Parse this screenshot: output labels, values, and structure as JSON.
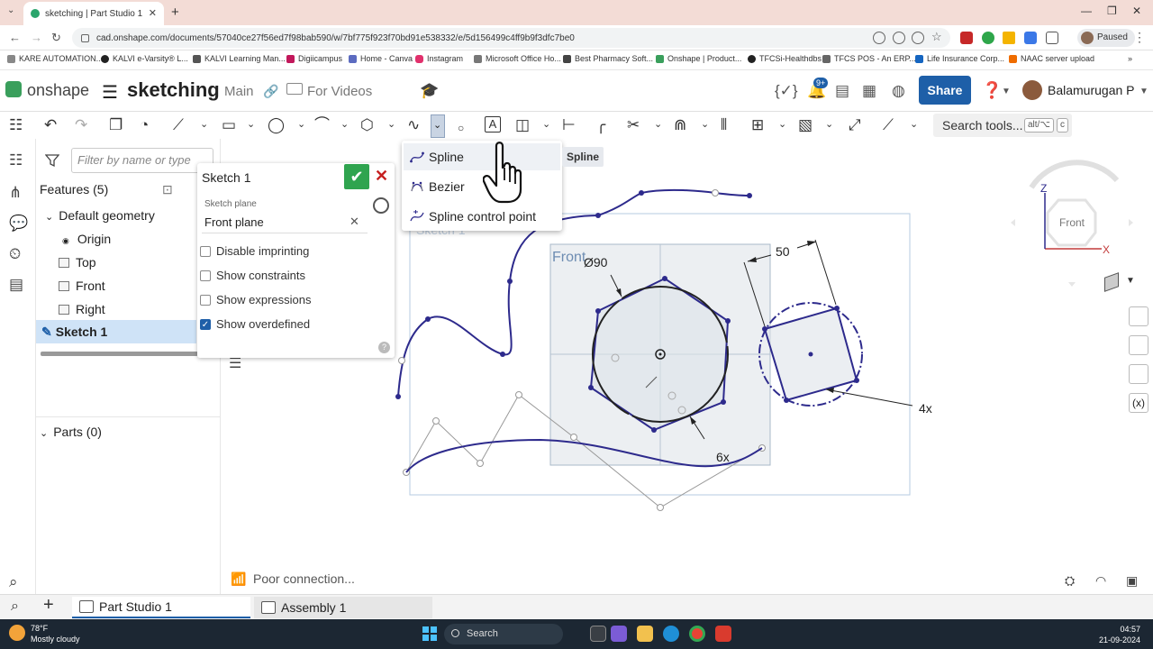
{
  "browser": {
    "tab_title": "sketching | Part Studio 1",
    "url": "cad.onshape.com/documents/57040ce27f56ed7f98bab590/w/7bf775f923f70bd91e538332/e/5d156499c4ff9b9f3dfc7be0",
    "profile_status": "Paused",
    "bookmarks": [
      "KARE AUTOMATION...",
      "KALVI e-Varsity® L...",
      "KALVI Learning Man...",
      "Digiicampus",
      "Home - Canva",
      "Instagram",
      "Microsoft Office Ho...",
      "Best Pharmacy Soft...",
      "Onshape | Product...",
      "TFCSi-Healthdbs",
      "TFCS POS - An ERP...",
      "Life Insurance Corp...",
      "NAAC server upload"
    ],
    "colors": {
      "tabbar": "#f3dcd6"
    }
  },
  "app": {
    "logo_text": "onshape",
    "document_title": "sketching",
    "workspace": "Main",
    "folder": "For Videos",
    "share_label": "Share",
    "notification_count": "9+",
    "user_name": "Balamurugan P",
    "accent": "#1e5fa8"
  },
  "toolbar": {
    "search_label": "Search tools...",
    "search_key1": "alt/⌥",
    "search_key2": "c"
  },
  "dropdown": {
    "items": [
      {
        "label": "Spline",
        "icon": "spline-icon"
      },
      {
        "label": "Bezier",
        "icon": "bezier-icon"
      },
      {
        "label": "Spline control point",
        "icon": "spline-control-point-icon"
      }
    ],
    "tooltip": "Spline"
  },
  "features": {
    "filter_placeholder": "Filter by name or type",
    "header": "Features (5)",
    "default_geometry": "Default geometry",
    "origin": "Origin",
    "top": "Top",
    "front": "Front",
    "right": "Right",
    "sketch": "Sketch 1",
    "parts": "Parts (0)"
  },
  "sketch_dialog": {
    "title": "Sketch 1",
    "plane_label": "Sketch plane",
    "plane_value": "Front plane",
    "options": [
      {
        "label": "Disable imprinting",
        "checked": false
      },
      {
        "label": "Show constraints",
        "checked": false
      },
      {
        "label": "Show expressions",
        "checked": false
      },
      {
        "label": "Show overdefined",
        "checked": true
      }
    ]
  },
  "canvas": {
    "sketch_label": "Sketch 1",
    "plane_label": "Front",
    "dim_diameter": "Ø90",
    "dim_length": "50",
    "dim_hex_count": "6x",
    "dim_square_count": "4x",
    "view_label": "Front",
    "axis_z": "Z",
    "axis_x": "X"
  },
  "status": {
    "connection": "Poor connection..."
  },
  "tabs": {
    "part_studio": "Part Studio 1",
    "assembly": "Assembly 1"
  },
  "taskbar": {
    "temperature": "78°F",
    "weather": "Mostly cloudy",
    "search": "Search",
    "time": "04:57",
    "date": "21-09-2024"
  }
}
